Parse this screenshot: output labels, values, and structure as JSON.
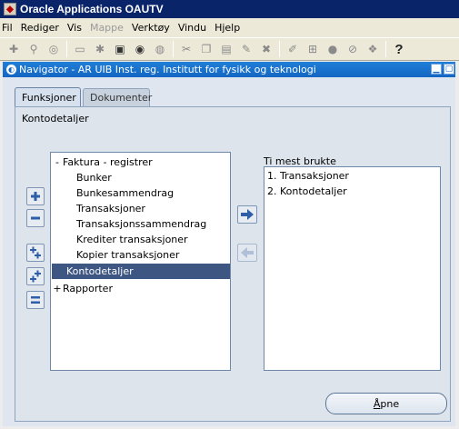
{
  "app_title": "Oracle Applications OAUTV",
  "menu": {
    "items": [
      {
        "label": "Fil",
        "disabled": false
      },
      {
        "label": "Rediger",
        "disabled": false
      },
      {
        "label": "Vis",
        "disabled": false
      },
      {
        "label": "Mappe",
        "disabled": true
      },
      {
        "label": "Verktøy",
        "disabled": false
      },
      {
        "label": "Vindu",
        "disabled": false
      },
      {
        "label": "Hjelp",
        "disabled": false
      }
    ]
  },
  "toolbar": {
    "help_glyph": "?"
  },
  "navigator": {
    "title": "Navigator - AR UIB Inst. reg. Institutt for fysikk og teknologi",
    "tabs": [
      {
        "label": "Funksjoner",
        "active": true
      },
      {
        "label": "Dokumenter",
        "active": false
      }
    ],
    "section_title": "Kontodetaljer",
    "tree": [
      {
        "label": "Faktura - registrer",
        "prefix": "-",
        "level": 0,
        "selected": false
      },
      {
        "label": "Bunker",
        "prefix": "",
        "level": 1,
        "selected": false
      },
      {
        "label": "Bunkesammendrag",
        "prefix": "",
        "level": 1,
        "selected": false
      },
      {
        "label": "Transaksjoner",
        "prefix": "",
        "level": 1,
        "selected": false
      },
      {
        "label": "Transaksjonssammendrag",
        "prefix": "",
        "level": 1,
        "selected": false
      },
      {
        "label": "Krediter transaksjoner",
        "prefix": "",
        "level": 1,
        "selected": false
      },
      {
        "label": "Kopier transaksjoner",
        "prefix": "",
        "level": 1,
        "selected": false
      },
      {
        "label": "Kontodetaljer",
        "prefix": "",
        "level": 1,
        "selected": true
      },
      {
        "label": "Rapporter",
        "prefix": "+",
        "level": 0,
        "selected": false
      }
    ],
    "recent_label": "Ti mest brukte",
    "recent_items": [
      "1. Transaksjoner",
      "2. Kontodetaljer"
    ],
    "open_button": {
      "underlined": "Å",
      "rest": "pne"
    }
  },
  "colors": {
    "app_titlebar": "#0a246a",
    "window_titlebar": "#1466c2",
    "selection": "#3d5682",
    "panel": "#dde4ec"
  }
}
